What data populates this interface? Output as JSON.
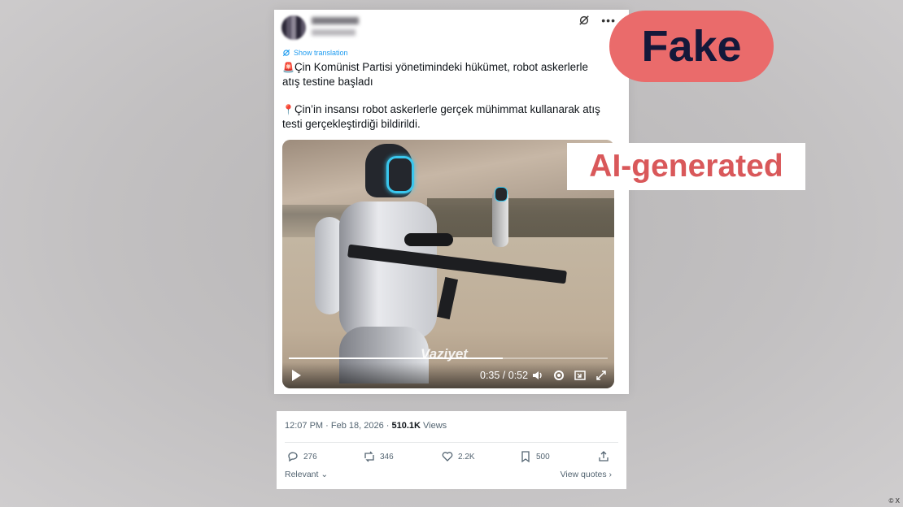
{
  "tweet": {
    "show_translation": "Show translation",
    "paragraph1": "Çin Komünist Partisi yönetimindeki hükümet, robot askerlerle atış testine başladı",
    "paragraph2": "Çin’in insansı robot askerlerle gerçek mühimmat kullanarak atış testi gerçekleştirdiği bildirildi.",
    "emoji1": "🚨",
    "emoji2": "📍"
  },
  "video": {
    "watermark": "Vaziyet",
    "time": "0:35 / 0:52",
    "progress": 0.67
  },
  "meta": {
    "time": "12:07 PM · Feb 18, 2026 · ",
    "views_count": "510.1K",
    "views_label": " Views",
    "replies": "276",
    "reposts": "346",
    "likes": "2.2K",
    "bookmarks": "500",
    "relevant": "Relevant",
    "view_quotes": "View quotes"
  },
  "overlay": {
    "fake": "Fake",
    "ai_generated": "AI-generated",
    "credit": "© X"
  },
  "colors": {
    "fake_bg": "#ea6b6b",
    "fake_text": "#14183a",
    "ai_text": "#d9585a",
    "link": "#1d9bf0"
  }
}
